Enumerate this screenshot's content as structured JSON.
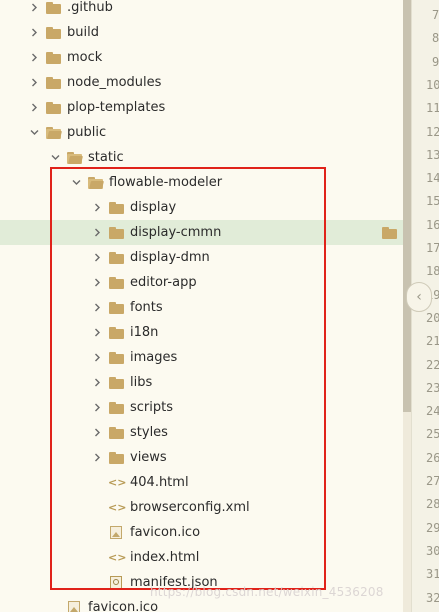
{
  "tree": [
    {
      "label": ".github",
      "type": "folder",
      "expanded": false
    },
    {
      "label": "build",
      "type": "folder",
      "expanded": false
    },
    {
      "label": "mock",
      "type": "folder",
      "expanded": false
    },
    {
      "label": "node_modules",
      "type": "folder",
      "expanded": false
    },
    {
      "label": "plop-templates",
      "type": "folder",
      "expanded": false
    },
    {
      "label": "public",
      "type": "folder",
      "expanded": true
    },
    {
      "label": "static",
      "type": "folder",
      "expanded": true
    },
    {
      "label": "flowable-modeler",
      "type": "folder",
      "expanded": true
    },
    {
      "label": "display",
      "type": "folder",
      "expanded": false
    },
    {
      "label": "display-cmmn",
      "type": "folder",
      "expanded": false,
      "selected": true
    },
    {
      "label": "display-dmn",
      "type": "folder",
      "expanded": false
    },
    {
      "label": "editor-app",
      "type": "folder",
      "expanded": false
    },
    {
      "label": "fonts",
      "type": "folder",
      "expanded": false
    },
    {
      "label": "i18n",
      "type": "folder",
      "expanded": false
    },
    {
      "label": "images",
      "type": "folder",
      "expanded": false
    },
    {
      "label": "libs",
      "type": "folder",
      "expanded": false
    },
    {
      "label": "scripts",
      "type": "folder",
      "expanded": false
    },
    {
      "label": "styles",
      "type": "folder",
      "expanded": false
    },
    {
      "label": "views",
      "type": "folder",
      "expanded": false
    },
    {
      "label": "404.html",
      "type": "html"
    },
    {
      "label": "browserconfig.xml",
      "type": "xml"
    },
    {
      "label": "favicon.ico",
      "type": "image"
    },
    {
      "label": "index.html",
      "type": "html"
    },
    {
      "label": "manifest.json",
      "type": "json"
    },
    {
      "label": "favicon.ico",
      "type": "image"
    }
  ],
  "line_numbers": [
    "7",
    "8",
    "9",
    "10",
    "11",
    "12",
    "13",
    "14",
    "15",
    "16",
    "17",
    "18",
    "19",
    "20",
    "21",
    "22",
    "23",
    "24",
    "25",
    "26",
    "27",
    "28",
    "29",
    "30",
    "31",
    "32"
  ],
  "watermark": "https://blog.csdn.net/weixin_4536208",
  "colors": {
    "selection": "#e1ecd8",
    "highlight_box": "#e0221a",
    "folder": "#c9a867"
  }
}
